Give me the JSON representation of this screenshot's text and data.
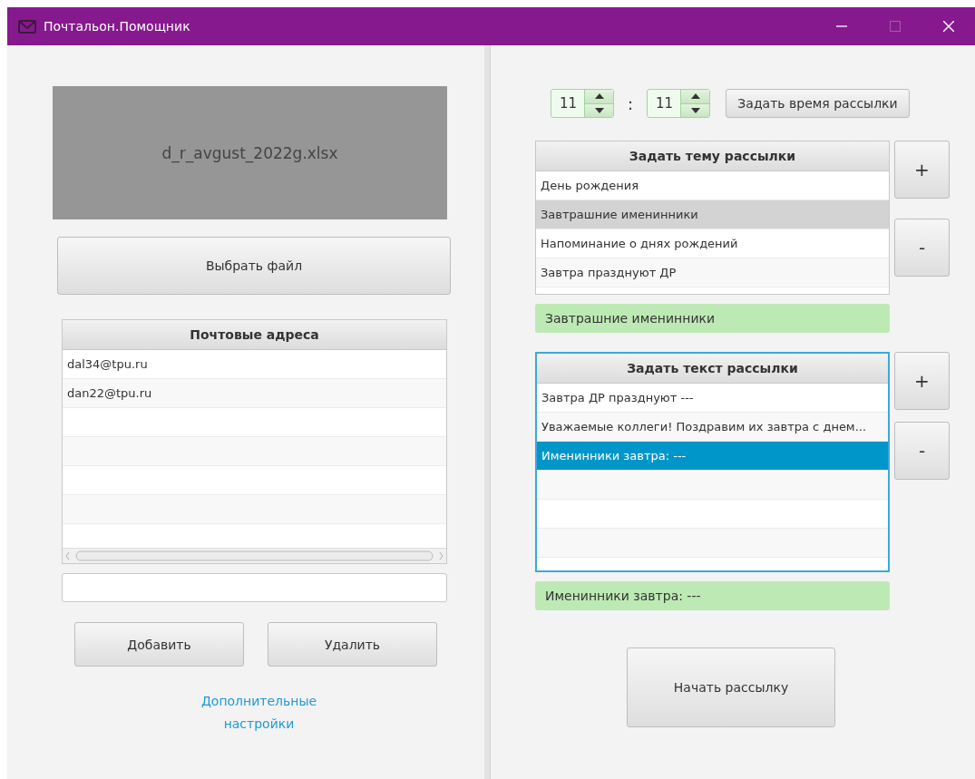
{
  "window": {
    "title": "Почтальон.Помощник",
    "controls": [
      {
        "kind": "minimize",
        "disabled": false
      },
      {
        "kind": "maximize",
        "disabled": true
      },
      {
        "kind": "close",
        "disabled": false
      }
    ]
  },
  "file": {
    "name": "d_r_avgust_2022g.xlsx"
  },
  "choose_file_button": "Выбрать файл",
  "addresses": {
    "header": "Почтовые адреса",
    "rows": [
      "dal34@tpu.ru",
      "dan22@tpu.ru"
    ]
  },
  "address_buttons": [
    "Добавить",
    "Удалить"
  ],
  "settings_link": "Дополнительные настройки",
  "time": {
    "hours": "11",
    "separator": ":",
    "minutes": "11"
  },
  "set_time_button": "Задать время рассылки",
  "subject": {
    "header": "Задать тему рассылки",
    "focused": false,
    "items": [
      {
        "text": "День рождения",
        "selected": false
      },
      {
        "text": "Завтрашние именинники",
        "selected": true
      },
      {
        "text": "Напоминание о днях рождений",
        "selected": false
      },
      {
        "text": "Завтра празднуют ДР",
        "selected": false
      }
    ],
    "buttons": [
      "+",
      "-"
    ],
    "current": "Завтрашние именинники"
  },
  "message": {
    "header": "Задать текст рассылки",
    "focused": true,
    "items": [
      {
        "text": "Завтра ДР празднуют ---",
        "selected": false
      },
      {
        "text": "Уважаемые коллеги! Поздравим их завтра с днем...",
        "selected": false
      },
      {
        "text": "Именинники завтра: ---",
        "selected": true
      }
    ],
    "buttons": [
      "+",
      "-"
    ],
    "current": "Именинники завтра: ---"
  },
  "start_button": "Начать рассылку"
}
